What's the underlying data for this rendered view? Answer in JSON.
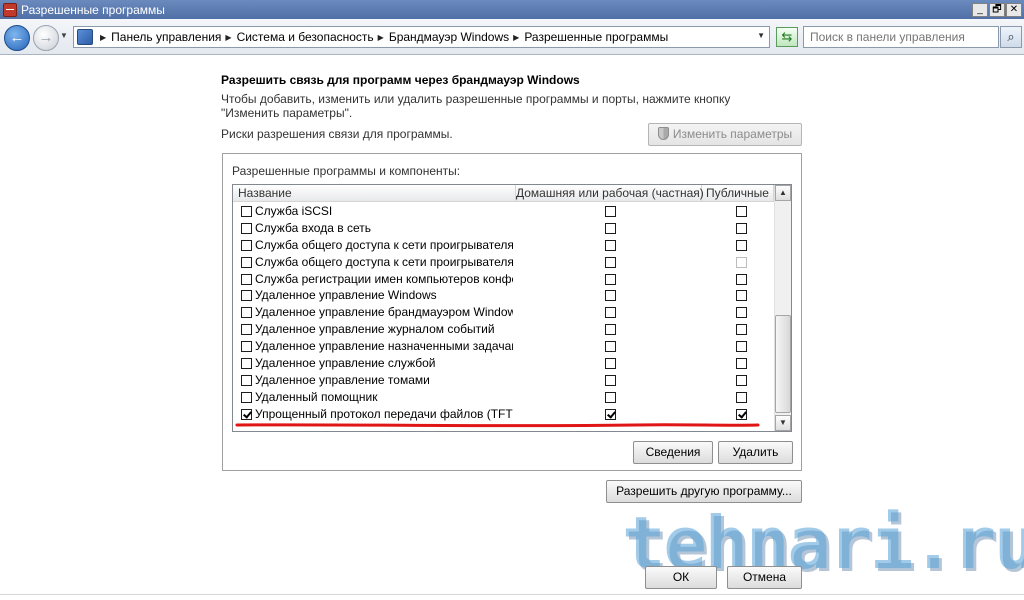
{
  "window": {
    "title": "Разрешенные программы",
    "controls": {
      "minimize": "_",
      "maximize": "🗗",
      "close": "✕"
    }
  },
  "addressbar": {
    "back_icon": "←",
    "forward_icon": "→",
    "crumbs": [
      "Панель управления",
      "Система и безопасность",
      "Брандмауэр Windows",
      "Разрешенные программы"
    ],
    "search_placeholder": "Поиск в панели управления",
    "refresh_icon": "⇆",
    "search_icon": "⌕"
  },
  "content": {
    "heading": "Разрешить связь для программ через брандмауэр Windows",
    "description": "Чтобы добавить, изменить или удалить разрешенные программы и порты, нажмите кнопку \"Изменить параметры\".",
    "risk_link": "Риски разрешения связи для программы.",
    "change_settings_button": "Изменить параметры",
    "group_label": "Разрешенные программы и компоненты:",
    "columns": {
      "name": "Название",
      "home": "Домашняя или рабочая (частная)",
      "public": "Публичные"
    },
    "rows": [
      {
        "name": "Служба iSCSI",
        "enabled": false,
        "home": false,
        "public": false,
        "public_dim": false
      },
      {
        "name": "Служба входа в сеть",
        "enabled": false,
        "home": false,
        "public": false,
        "public_dim": false
      },
      {
        "name": "Служба общего доступа к сети проигрывателя ...",
        "enabled": false,
        "home": false,
        "public": false,
        "public_dim": false
      },
      {
        "name": "Служба общего доступа к сети проигрывателя ...",
        "enabled": false,
        "home": false,
        "public": false,
        "public_dim": true
      },
      {
        "name": "Служба регистрации имен компьютеров конфер...",
        "enabled": false,
        "home": false,
        "public": false,
        "public_dim": false
      },
      {
        "name": "Удаленное управление Windows",
        "enabled": false,
        "home": false,
        "public": false,
        "public_dim": false
      },
      {
        "name": "Удаленное управление брандмауэром Windows",
        "enabled": false,
        "home": false,
        "public": false,
        "public_dim": false
      },
      {
        "name": "Удаленное управление журналом событий",
        "enabled": false,
        "home": false,
        "public": false,
        "public_dim": false
      },
      {
        "name": "Удаленное управление назначенными задачами",
        "enabled": false,
        "home": false,
        "public": false,
        "public_dim": false
      },
      {
        "name": "Удаленное управление службой",
        "enabled": false,
        "home": false,
        "public": false,
        "public_dim": false
      },
      {
        "name": "Удаленное управление томами",
        "enabled": false,
        "home": false,
        "public": false,
        "public_dim": false
      },
      {
        "name": "Удаленный помощник",
        "enabled": false,
        "home": false,
        "public": false,
        "public_dim": false
      },
      {
        "name": "Упрощенный протокол передачи файлов (TFTP)",
        "enabled": true,
        "home": true,
        "public": true,
        "public_dim": false
      }
    ],
    "details_button": "Сведения",
    "remove_button": "Удалить",
    "allow_another_button": "Разрешить другую программу...",
    "ok_button": "ОК",
    "cancel_button": "Отмена",
    "watermark": "tehnari.ru",
    "highlight_color": "#e01515"
  }
}
